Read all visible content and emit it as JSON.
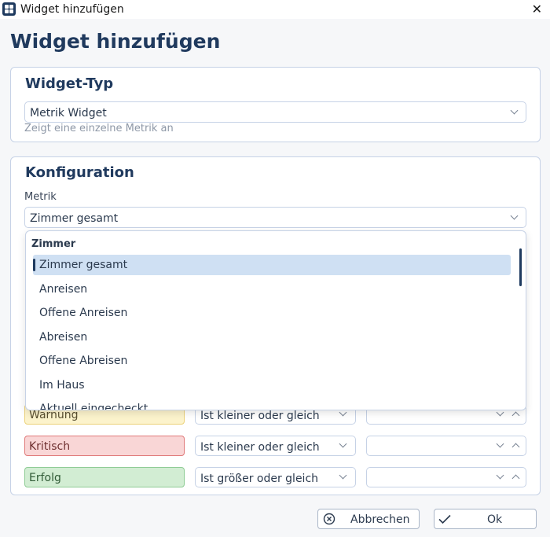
{
  "window": {
    "title": "Widget hinzufügen"
  },
  "page": {
    "title": "Widget hinzufügen"
  },
  "widget_type": {
    "section_title": "Widget-Typ",
    "selected": "Metrik Widget",
    "hint": "Zeigt eine einzelne Metrik an"
  },
  "configuration": {
    "section_title": "Konfiguration",
    "metric_label": "Metrik",
    "metric_selected": "Zimmer gesamt",
    "dropdown": {
      "group": "Zimmer",
      "options": [
        "Zimmer gesamt",
        "Anreisen",
        "Offene Anreisen",
        "Abreisen",
        "Offene Abreisen",
        "Im Haus",
        "Aktuell eingecheckt"
      ]
    },
    "thresholds": [
      {
        "label": "Warnung",
        "operator": "Ist kleiner oder gleich",
        "value": "",
        "color": "#fcf3cc"
      },
      {
        "label": "Kritisch",
        "operator": "Ist kleiner oder gleich",
        "value": "",
        "color": "#f9d6d6"
      },
      {
        "label": "Erfolg",
        "operator": "Ist größer oder gleich",
        "value": "",
        "color": "#d2edd3"
      }
    ]
  },
  "buttons": {
    "cancel": "Abbrechen",
    "ok": "Ok"
  },
  "icons": {
    "app": "widgets-icon",
    "close": "close-icon",
    "cancel": "circle-x-icon",
    "ok": "checkmark-icon"
  },
  "colors": {
    "accent": "#1e3a5f",
    "selection": "#cfe0f3",
    "title": "#203a5e"
  }
}
